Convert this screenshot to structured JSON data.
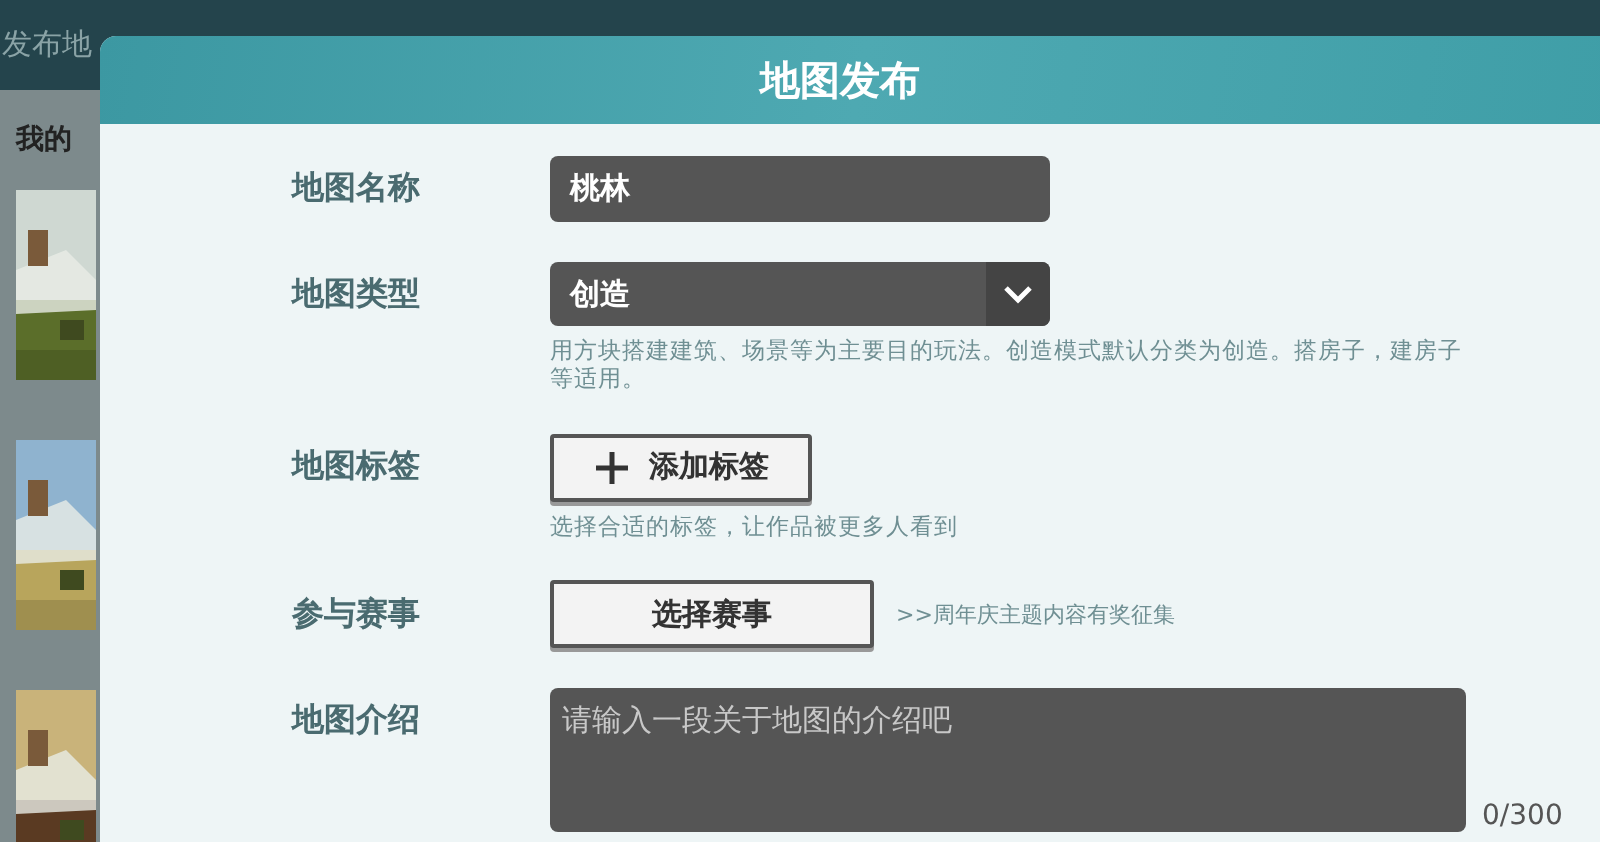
{
  "background": {
    "title": "发布地",
    "section": "我的"
  },
  "dialog": {
    "title": "地图发布",
    "fields": [
      {
        "kind": "text",
        "label": "地图名称",
        "value": "桃林"
      },
      {
        "kind": "dropdown",
        "label": "地图类型",
        "value": "创造",
        "hint": "用方块搭建建筑、场景等为主要目的玩法。创造模式默认分类为创造。搭房子，建房子等适用。"
      },
      {
        "kind": "button",
        "label": "地图标签",
        "button": "添加标签",
        "plus_icon": true,
        "hint": "选择合适的标签，让作品被更多人看到"
      },
      {
        "kind": "button",
        "label": "参与赛事",
        "button": "选择赛事",
        "plus_icon": false,
        "note": ">>周年庆主题内容有奖征集"
      },
      {
        "kind": "textarea",
        "label": "地图介绍",
        "placeholder": "请输入一段关于地图的介绍吧",
        "counter": "0/300"
      }
    ]
  }
}
